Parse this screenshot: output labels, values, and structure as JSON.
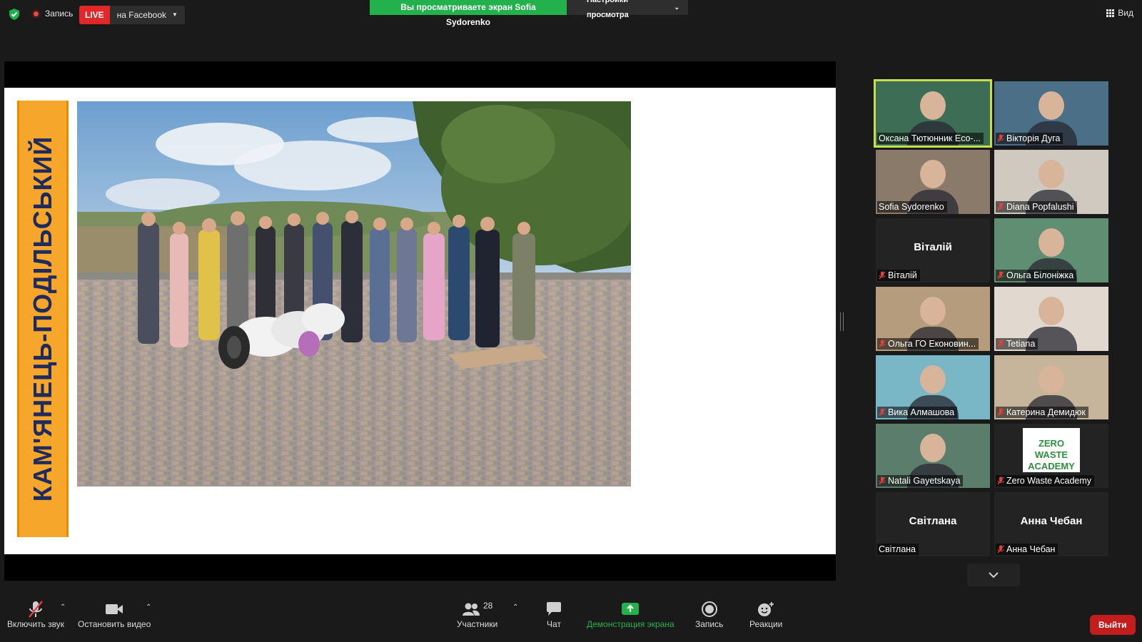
{
  "top": {
    "recording_label": "Запись",
    "live_badge": "LIVE",
    "live_destination": "на Facebook",
    "share_banner": "Вы просматриваете экран Sofia Sydorenko",
    "view_options": "Настройки просмотра",
    "view_button": "Вид"
  },
  "slide": {
    "vertical_title": "КАМ'ЯНЕЦЬ-ПОДІЛЬСЬКИЙ"
  },
  "participants": [
    {
      "name": "Оксана Тютюнник Eco-...",
      "muted": false,
      "video": true,
      "active": true,
      "bg": "#3d6e55"
    },
    {
      "name": "Вікторія Дуга",
      "muted": true,
      "video": true,
      "active": false,
      "bg": "#4a6f86"
    },
    {
      "name": "Sofia Sydorenko",
      "muted": false,
      "video": true,
      "active": false,
      "bg": "#8a7a6a"
    },
    {
      "name": "Diana Popfalushi",
      "muted": true,
      "video": true,
      "active": false,
      "bg": "#cfc9c0"
    },
    {
      "name": "Віталій",
      "display": "Віталій",
      "muted": true,
      "video": false,
      "active": false
    },
    {
      "name": "Ольга Білоніжка",
      "muted": true,
      "video": true,
      "active": false,
      "bg": "#5f8e72"
    },
    {
      "name": "Ольга  ГО Еконовин...",
      "muted": true,
      "video": true,
      "active": false,
      "bg": "#b59c7c"
    },
    {
      "name": "Tetiana",
      "muted": true,
      "video": true,
      "active": false,
      "bg": "#e1d8cf"
    },
    {
      "name": "Вика Алмашова",
      "muted": true,
      "video": true,
      "active": false,
      "bg": "#79b7c7"
    },
    {
      "name": "Катерина Демидюк",
      "muted": true,
      "video": true,
      "active": false,
      "bg": "#c6b59b"
    },
    {
      "name": "Natali Gayetskaya",
      "muted": true,
      "video": true,
      "active": false,
      "bg": "#5b7e6c"
    },
    {
      "name": "Zero Waste Academy",
      "muted": true,
      "video": true,
      "active": false,
      "bg": "#ffffff",
      "logo": "ZERO WASTE ACADEMY"
    },
    {
      "name": "Світлана",
      "display": "Світлана",
      "muted": false,
      "video": false,
      "active": false
    },
    {
      "name": "Анна Чебан",
      "display": "Анна Чебан",
      "muted": true,
      "video": false,
      "active": false
    }
  ],
  "toolbar": {
    "unmute": "Включить звук",
    "stop_video": "Остановить видео",
    "participants": "Участники",
    "participants_count": "28",
    "chat": "Чат",
    "share_screen": "Демонстрация экрана",
    "record": "Запись",
    "reactions": "Реакции",
    "leave": "Выйти"
  },
  "colors": {
    "accent_green": "#22b14c",
    "live_red": "#e02828",
    "active_speaker": "#c6e04d",
    "leave_red": "#c41d1d",
    "slide_band": "#f6a62a"
  }
}
